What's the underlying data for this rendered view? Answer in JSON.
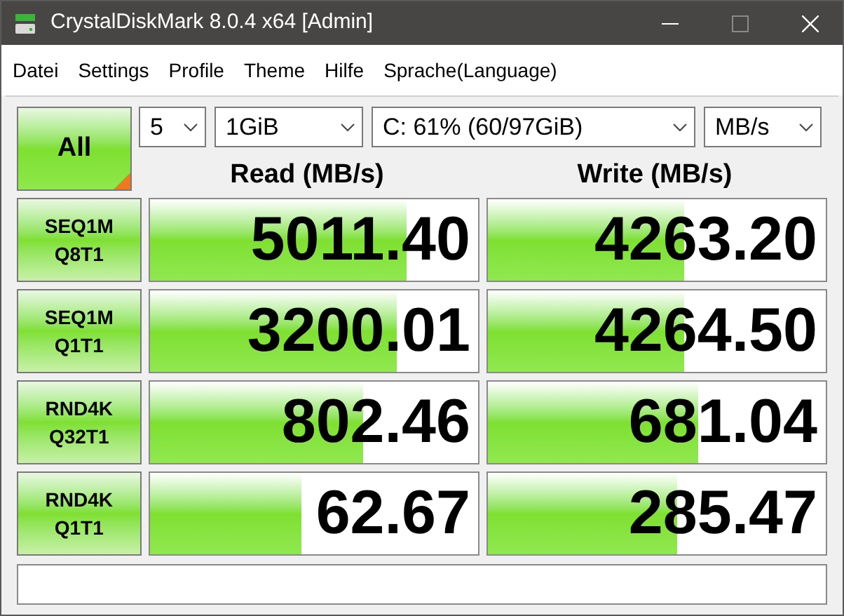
{
  "window": {
    "title": "CrystalDiskMark 8.0.4 x64 [Admin]"
  },
  "menu": [
    "Datei",
    "Settings",
    "Profile",
    "Theme",
    "Hilfe",
    "Sprache(Language)"
  ],
  "all_button": "All",
  "selectors": [
    {
      "value": "5"
    },
    {
      "value": "1GiB"
    },
    {
      "value": "C: 61% (60/97GiB)"
    },
    {
      "value": "MB/s"
    }
  ],
  "headers": [
    "Read (MB/s)",
    "Write (MB/s)"
  ],
  "rows": [
    {
      "test": [
        "SEQ1M",
        "Q8T1"
      ],
      "read": {
        "value": "5011.40",
        "level": 0.78
      },
      "write": {
        "value": "4263.20",
        "level": 0.58
      }
    },
    {
      "test": [
        "SEQ1M",
        "Q1T1"
      ],
      "read": {
        "value": "3200.01",
        "level": 0.75
      },
      "write": {
        "value": "4264.50",
        "level": 0.58
      }
    },
    {
      "test": [
        "RND4K",
        "Q32T1"
      ],
      "read": {
        "value": "802.46",
        "level": 0.65
      },
      "write": {
        "value": "681.04",
        "level": 0.62
      }
    },
    {
      "test": [
        "RND4K",
        "Q1T1"
      ],
      "read": {
        "value": "62.67",
        "level": 0.46
      },
      "write": {
        "value": "285.47",
        "level": 0.56
      }
    }
  ]
}
